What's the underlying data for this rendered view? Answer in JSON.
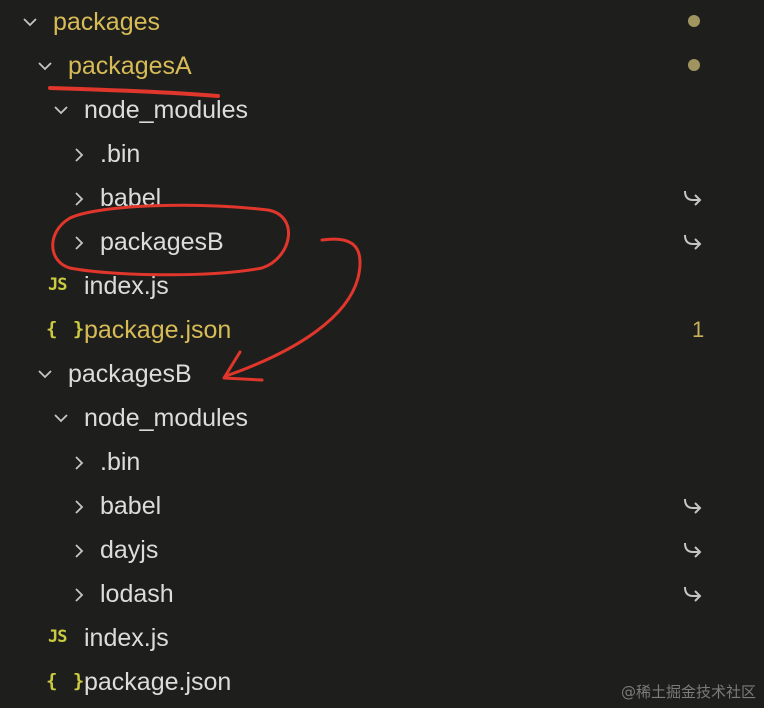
{
  "explorer": {
    "rows": [
      {
        "label": "packages",
        "kind": "folder",
        "expanded": true,
        "modified": true,
        "decoration": "dot"
      },
      {
        "label": "packagesA",
        "kind": "folder",
        "expanded": true,
        "modified": true,
        "decoration": "dot"
      },
      {
        "label": "node_modules",
        "kind": "folder",
        "expanded": true
      },
      {
        "label": ".bin",
        "kind": "folder",
        "expanded": false
      },
      {
        "label": "babel",
        "kind": "folder",
        "expanded": false,
        "decoration": "symlink"
      },
      {
        "label": "packagesB",
        "kind": "folder",
        "expanded": false,
        "decoration": "symlink"
      },
      {
        "label": "index.js",
        "kind": "file",
        "icon": "JS"
      },
      {
        "label": "package.json",
        "kind": "file",
        "icon": "{ }",
        "modified": true,
        "badge": "1"
      },
      {
        "label": "packagesB",
        "kind": "folder",
        "expanded": true
      },
      {
        "label": "node_modules",
        "kind": "folder",
        "expanded": true
      },
      {
        "label": ".bin",
        "kind": "folder",
        "expanded": false
      },
      {
        "label": "babel",
        "kind": "folder",
        "expanded": false,
        "decoration": "symlink"
      },
      {
        "label": "dayjs",
        "kind": "folder",
        "expanded": false,
        "decoration": "symlink"
      },
      {
        "label": "lodash",
        "kind": "folder",
        "expanded": false,
        "decoration": "symlink"
      },
      {
        "label": "index.js",
        "kind": "file",
        "icon": "JS"
      },
      {
        "label": "package.json",
        "kind": "file",
        "icon": "{ }"
      }
    ]
  },
  "colors": {
    "background": "#1e1f1c",
    "text": "#dcdcdc",
    "modified": "#d7bb57",
    "icon_yellow": "#cbcb41",
    "annotation_red": "#e0362c"
  },
  "watermark": "@稀土掘金技术社区"
}
